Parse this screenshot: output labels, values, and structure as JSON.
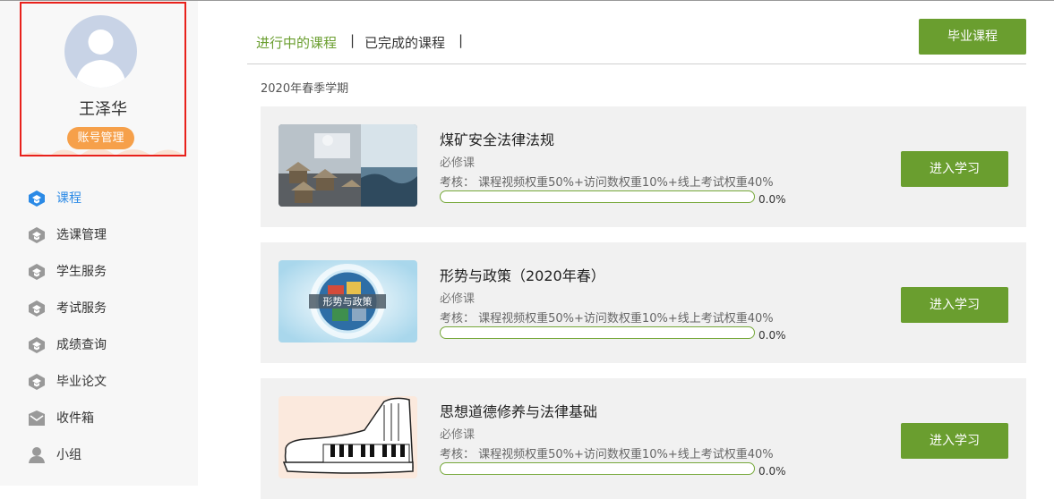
{
  "profile": {
    "name": "王泽华",
    "account_button": "账号管理"
  },
  "nav": [
    {
      "label": "课程",
      "icon": "course-icon",
      "active": true
    },
    {
      "label": "选课管理",
      "icon": "course-select-icon",
      "active": false
    },
    {
      "label": "学生服务",
      "icon": "student-service-icon",
      "active": false
    },
    {
      "label": "考试服务",
      "icon": "exam-service-icon",
      "active": false
    },
    {
      "label": "成绩查询",
      "icon": "grade-query-icon",
      "active": false
    },
    {
      "label": "毕业论文",
      "icon": "thesis-icon",
      "active": false
    },
    {
      "label": "收件箱",
      "icon": "inbox-icon",
      "active": false
    },
    {
      "label": "小组",
      "icon": "user-group-icon",
      "active": false
    }
  ],
  "tabs": {
    "active": "进行中的课程",
    "completed": "已完成的课程",
    "separator": "|"
  },
  "graduation_button": "毕业课程",
  "term": "2020年春季学期",
  "courses": [
    {
      "title": "煤矿安全法律法规",
      "type": "必修课",
      "assessment": "考核： 课程视频权重50%+访问数权重10%+线上考试权重40%",
      "progress_text": "0.0%",
      "progress": 0.0,
      "enter_label": "进入学习"
    },
    {
      "title": "形势与政策（2020年春）",
      "type": "必修课",
      "assessment": "考核： 课程视频权重50%+访问数权重10%+线上考试权重40%",
      "progress_text": "0.0%",
      "progress": 0.0,
      "thumb_caption": "形势与政策",
      "enter_label": "进入学习"
    },
    {
      "title": "思想道德修养与法律基础",
      "type": "必修课",
      "assessment": "考核： 课程视频权重50%+访问数权重10%+线上考试权重40%",
      "progress_text": "0.0%",
      "progress": 0.0,
      "enter_label": "进入学习"
    }
  ],
  "colors": {
    "accent_green": "#6a9e2f",
    "active_blue": "#2b8ae6",
    "badge_orange": "#f6a04a",
    "highlight_red": "#e8211c"
  }
}
